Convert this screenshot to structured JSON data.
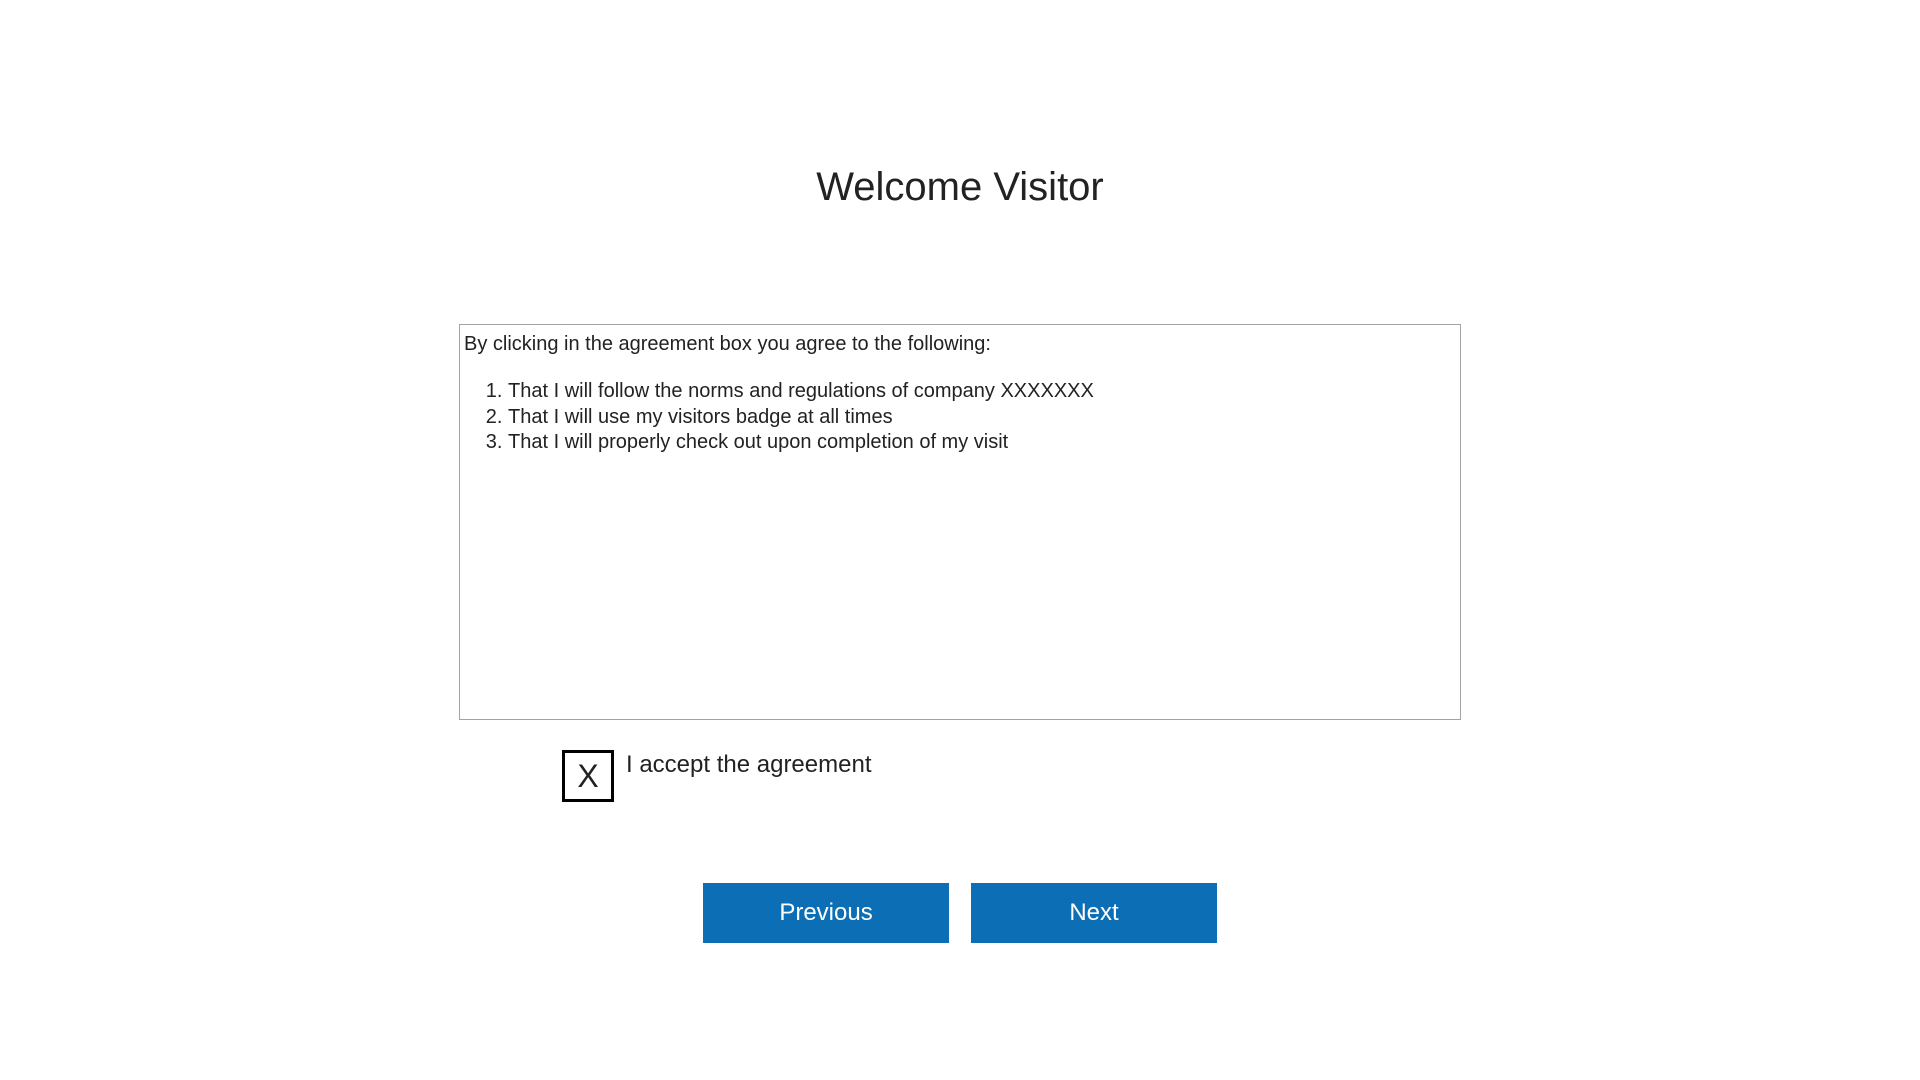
{
  "title": "Welcome Visitor",
  "agreement": {
    "intro": "By clicking in the agreement box you agree to the following:",
    "items": [
      "That I will follow the norms and regulations of company XXXXXXX",
      "That I will use my visitors badge at all times",
      "That I will properly check out upon completion of my visit"
    ]
  },
  "accept": {
    "checked_mark": "X",
    "label": "I accept the agreement"
  },
  "buttons": {
    "previous": "Previous",
    "next": "Next"
  }
}
